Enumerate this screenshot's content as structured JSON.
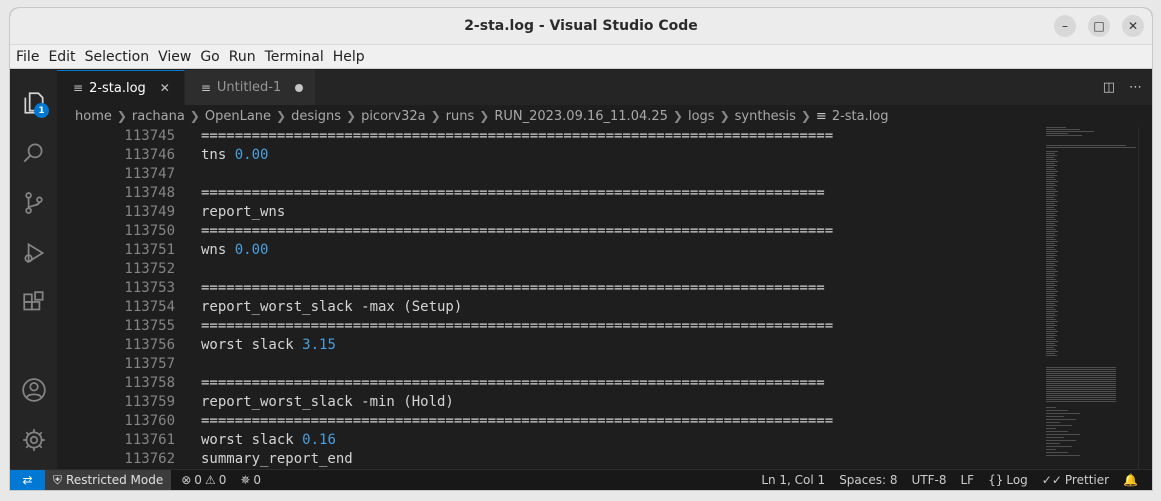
{
  "window": {
    "title": "2-sta.log - Visual Studio Code"
  },
  "menu": [
    "File",
    "Edit",
    "Selection",
    "View",
    "Go",
    "Run",
    "Terminal",
    "Help"
  ],
  "activity": {
    "explorer_badge": "1"
  },
  "tabs": [
    {
      "label": "2-sta.log",
      "active": true
    },
    {
      "label": "Untitled-1",
      "active": false,
      "dirty": true
    }
  ],
  "breadcrumb": [
    "home",
    "rachana",
    "OpenLane",
    "designs",
    "picorv32a",
    "runs",
    "RUN_2023.09.16_11.04.25",
    "logs",
    "synthesis",
    "2-sta.log"
  ],
  "code_lines": [
    {
      "n": "113745",
      "t": "===========================================================================",
      "v": ""
    },
    {
      "n": "113746",
      "t": "tns ",
      "v": "0.00"
    },
    {
      "n": "113747",
      "t": "",
      "v": ""
    },
    {
      "n": "113748",
      "t": "==========================================================================",
      "v": ""
    },
    {
      "n": "113749",
      "t": "report_wns",
      "v": ""
    },
    {
      "n": "113750",
      "t": "===========================================================================",
      "v": ""
    },
    {
      "n": "113751",
      "t": "wns ",
      "v": "0.00"
    },
    {
      "n": "113752",
      "t": "",
      "v": ""
    },
    {
      "n": "113753",
      "t": "==========================================================================",
      "v": ""
    },
    {
      "n": "113754",
      "t": "report_worst_slack -max (Setup)",
      "v": ""
    },
    {
      "n": "113755",
      "t": "===========================================================================",
      "v": ""
    },
    {
      "n": "113756",
      "t": "worst slack ",
      "v": "3.15"
    },
    {
      "n": "113757",
      "t": "",
      "v": ""
    },
    {
      "n": "113758",
      "t": "==========================================================================",
      "v": ""
    },
    {
      "n": "113759",
      "t": "report_worst_slack -min (Hold)",
      "v": ""
    },
    {
      "n": "113760",
      "t": "===========================================================================",
      "v": ""
    },
    {
      "n": "113761",
      "t": "worst slack ",
      "v": "0.16"
    },
    {
      "n": "113762",
      "t": "summary_report_end",
      "v": ""
    }
  ],
  "status": {
    "restricted": "Restricted Mode",
    "errors": "0",
    "warnings": "0",
    "ports": "0",
    "position": "Ln 1, Col 1",
    "spaces": "Spaces: 8",
    "encoding": "UTF-8",
    "eol": "LF",
    "language": "Log",
    "formatter": "Prettier"
  },
  "colors": {
    "accent": "#0078d4",
    "number": "#4a9fe0",
    "editor_bg": "#1e1e1e"
  }
}
